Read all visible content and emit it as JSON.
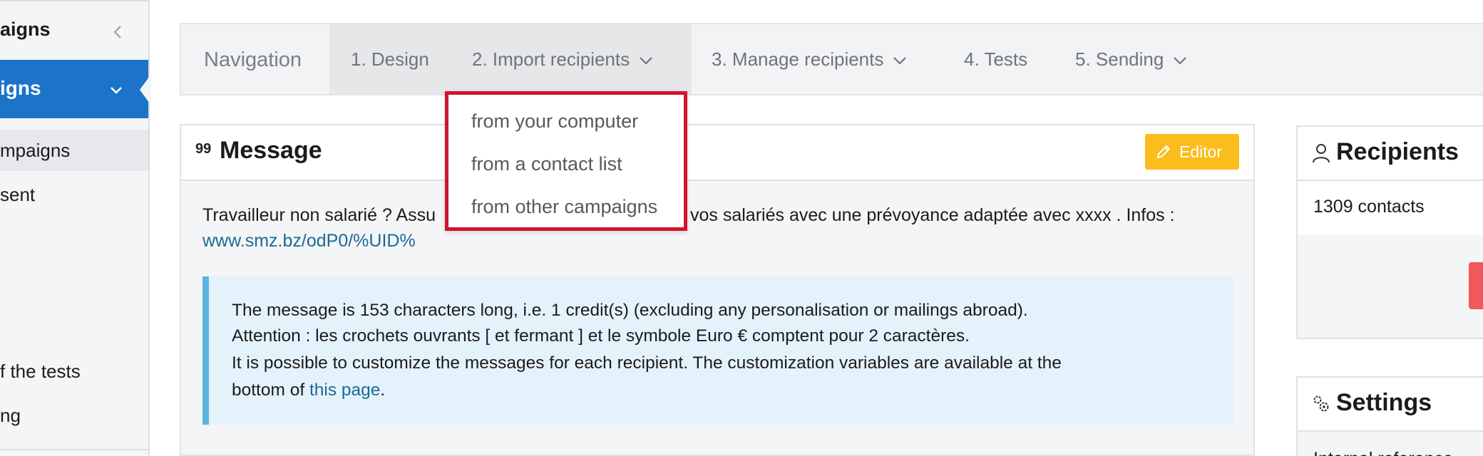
{
  "sidebar": {
    "header_label": "aigns",
    "active_label": "igns",
    "items": [
      {
        "label": "mpaigns",
        "selected": true
      },
      {
        "label": "sent",
        "selected": false
      },
      {
        "label": "f the tests",
        "selected": false
      },
      {
        "label": "ng",
        "selected": false
      }
    ]
  },
  "nav": {
    "title": "Navigation",
    "items": [
      {
        "label": "1. Design"
      },
      {
        "label": "2. Import recipients"
      },
      {
        "label": "3. Manage recipients"
      },
      {
        "label": "4. Tests"
      },
      {
        "label": "5. Sending"
      }
    ]
  },
  "dropdown": {
    "items": [
      {
        "label": "from your computer"
      },
      {
        "label": "from a contact list"
      },
      {
        "label": "from other campaigns"
      }
    ]
  },
  "message": {
    "icon_text": "99",
    "title": "Message",
    "editor_label": "Editor",
    "text_left": "Travailleur non salarié ? Assu",
    "text_right": "vos salariés avec une prévoyance adaptée avec xxxx . Infos :",
    "link": "www.smz.bz/odP0/%UID%",
    "info_lines": [
      "The message is 153 characters long, i.e. 1 credit(s) (excluding any personalisation or mailings abroad).",
      "Attention : les crochets ouvrants [ et fermant ] et le symbole Euro € comptent pour 2 caractères.",
      "It is possible to customize the messages for each recipient. The customization variables are available at the"
    ],
    "info_last_prefix": "bottom of ",
    "info_last_link": "this page",
    "info_last_suffix": "."
  },
  "recipients": {
    "title": "Recipients",
    "count": "1309 contacts"
  },
  "settings": {
    "title": "Settings",
    "partial_text": "Internal reference"
  },
  "colors": {
    "accent_blue": "#1b74c8",
    "highlight_red": "#d3122f",
    "editor_yellow": "#fbbd1b",
    "info_blue": "#5bb6e0",
    "link": "#1c6a94"
  }
}
